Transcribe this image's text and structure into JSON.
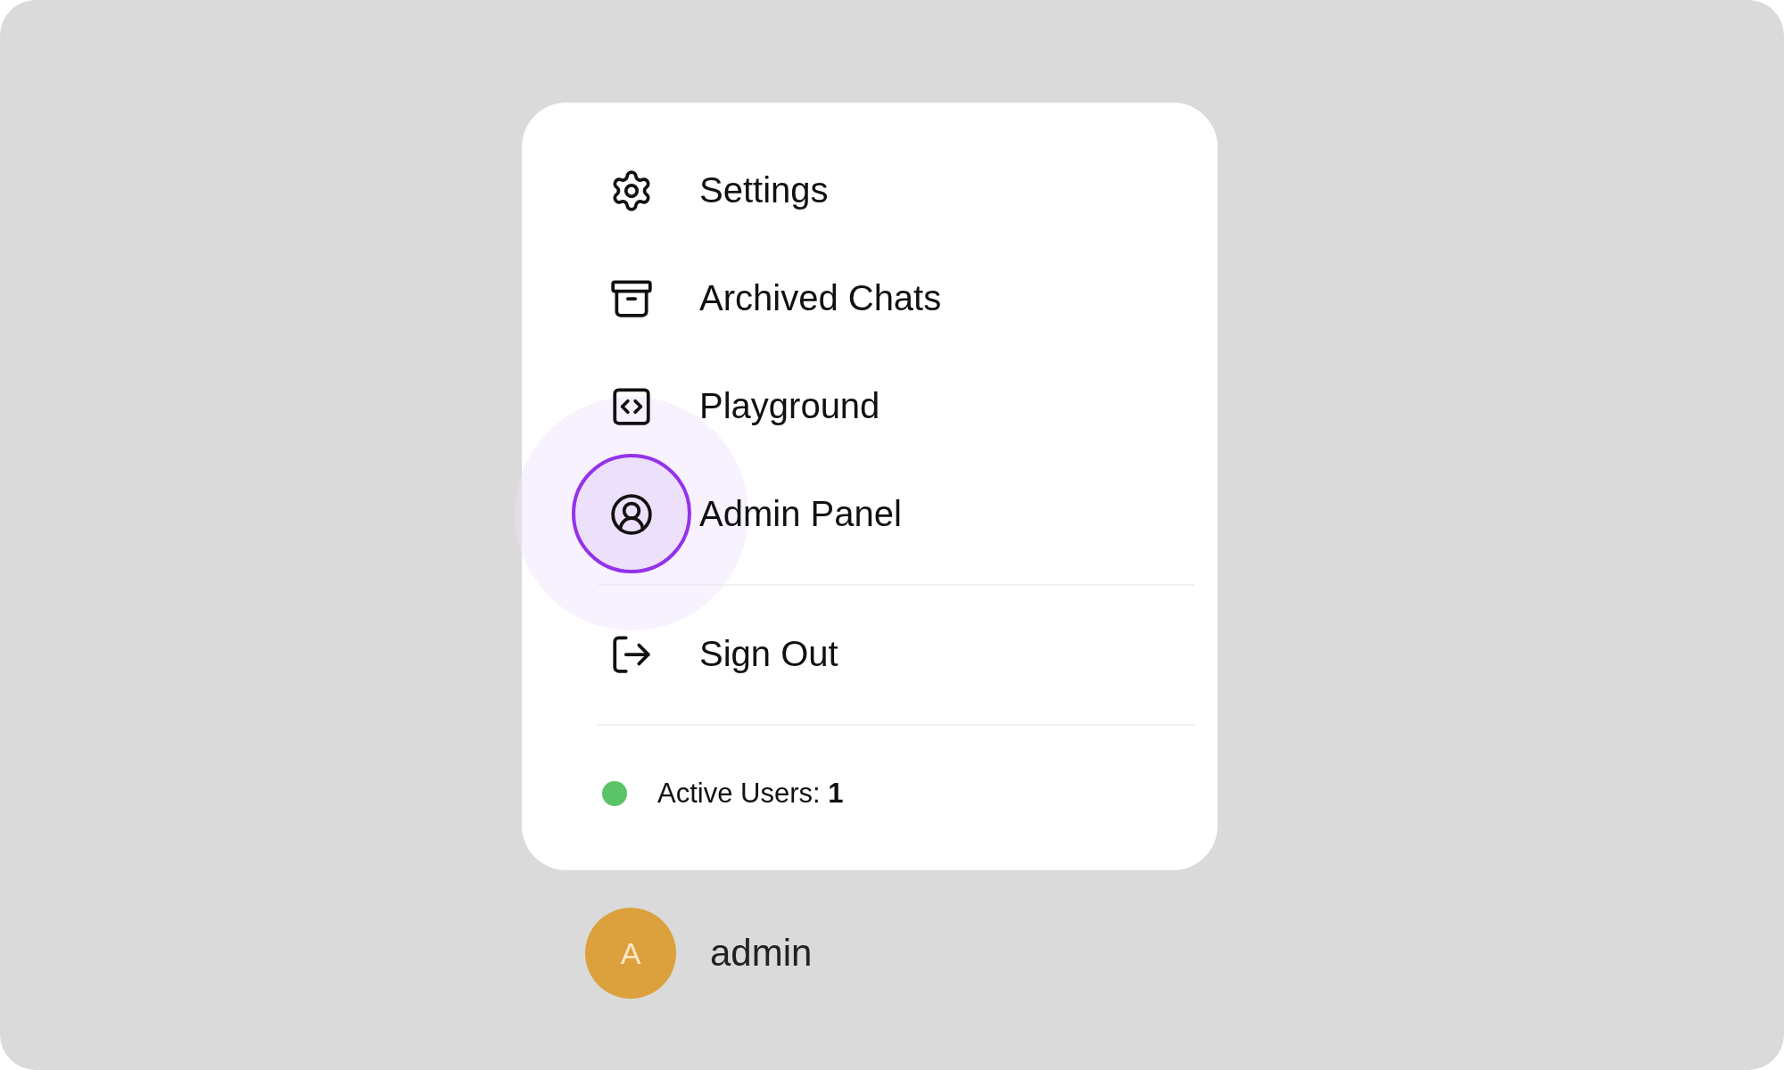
{
  "menu": {
    "items": [
      {
        "kind": "settings",
        "label": "Settings",
        "highlighted": false
      },
      {
        "kind": "archive",
        "label": "Archived Chats",
        "highlighted": false
      },
      {
        "kind": "code",
        "label": "Playground",
        "highlighted": false
      },
      {
        "kind": "user",
        "label": "Admin Panel",
        "highlighted": true
      },
      {
        "kind": "signout",
        "label": "Sign Out",
        "highlighted": false
      }
    ],
    "status": {
      "color": "#5cc468",
      "text": "Active Users: **1**"
    }
  },
  "user": {
    "initial": "A",
    "name": "admin"
  }
}
